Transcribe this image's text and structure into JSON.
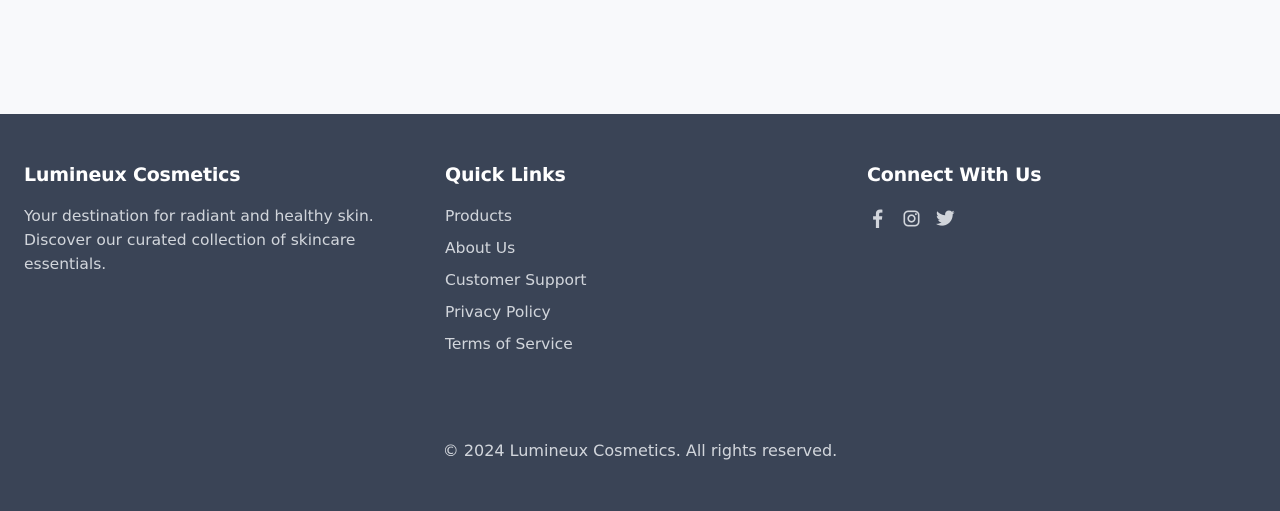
{
  "footer": {
    "brand": {
      "title": "Lumineux Cosmetics",
      "description": "Your destination for radiant and healthy skin. Discover our curated collection of skincare essentials."
    },
    "quick_links": {
      "title": "Quick Links",
      "items": [
        {
          "label": "Products"
        },
        {
          "label": "About Us"
        },
        {
          "label": "Customer Support"
        },
        {
          "label": "Privacy Policy"
        },
        {
          "label": "Terms of Service"
        }
      ]
    },
    "connect": {
      "title": "Connect With Us",
      "icons": [
        "facebook-icon",
        "instagram-icon",
        "twitter-icon"
      ]
    },
    "copyright": "© 2024 Lumineux Cosmetics. All rights reserved."
  },
  "colors": {
    "page_background": "#f8f9fb",
    "footer_background": "#3a4456",
    "heading_text": "#ffffff",
    "body_text": "#d1d5db"
  }
}
